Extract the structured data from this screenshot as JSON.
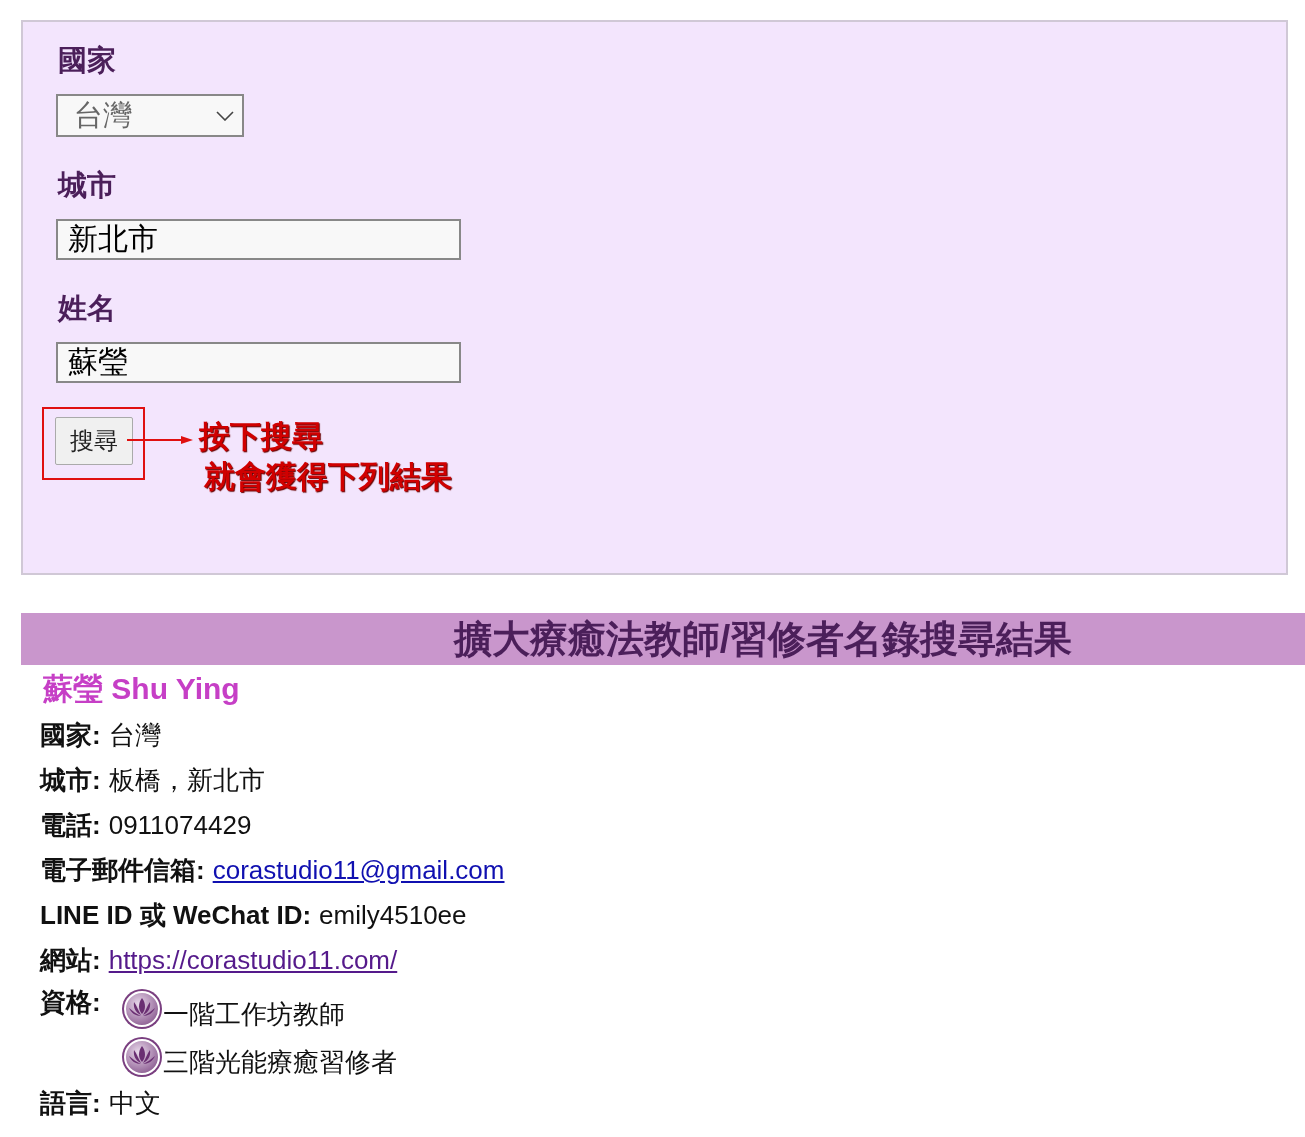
{
  "search_form": {
    "fields": [
      {
        "kind": "select",
        "label": "國家",
        "value": "台灣"
      },
      {
        "kind": "text",
        "label": "城市",
        "value": "新北市"
      },
      {
        "kind": "text",
        "label": "姓名",
        "value": "蘇瑩"
      }
    ],
    "search_button": "搜尋",
    "annotation": [
      "按下搜尋",
      "就會獲得下列結果"
    ]
  },
  "results": {
    "title": "擴大療癒法教師/習修者名錄搜尋結果",
    "name": "蘇瑩 Shu Ying",
    "details": [
      {
        "kind": "text",
        "label": "國家:",
        "value": "台灣"
      },
      {
        "kind": "text",
        "label": "城市:",
        "value": "板橋，新北市"
      },
      {
        "kind": "text",
        "label": "電話:",
        "value": "0911074429"
      },
      {
        "kind": "link",
        "label": "電子郵件信箱:",
        "value": "corastudio11@gmail.com",
        "visited": false
      },
      {
        "kind": "text",
        "label": "LINE ID 或 WeChat ID:",
        "value": "emily4510ee"
      },
      {
        "kind": "link",
        "label": "網站:",
        "value": "https://corastudio11.com/",
        "visited": true
      },
      {
        "kind": "list",
        "label": "資格:",
        "items": [
          "一階工作坊教師",
          "三階光能療癒習修者"
        ]
      },
      {
        "kind": "text",
        "label": "語言:",
        "value": "中文"
      }
    ]
  }
}
